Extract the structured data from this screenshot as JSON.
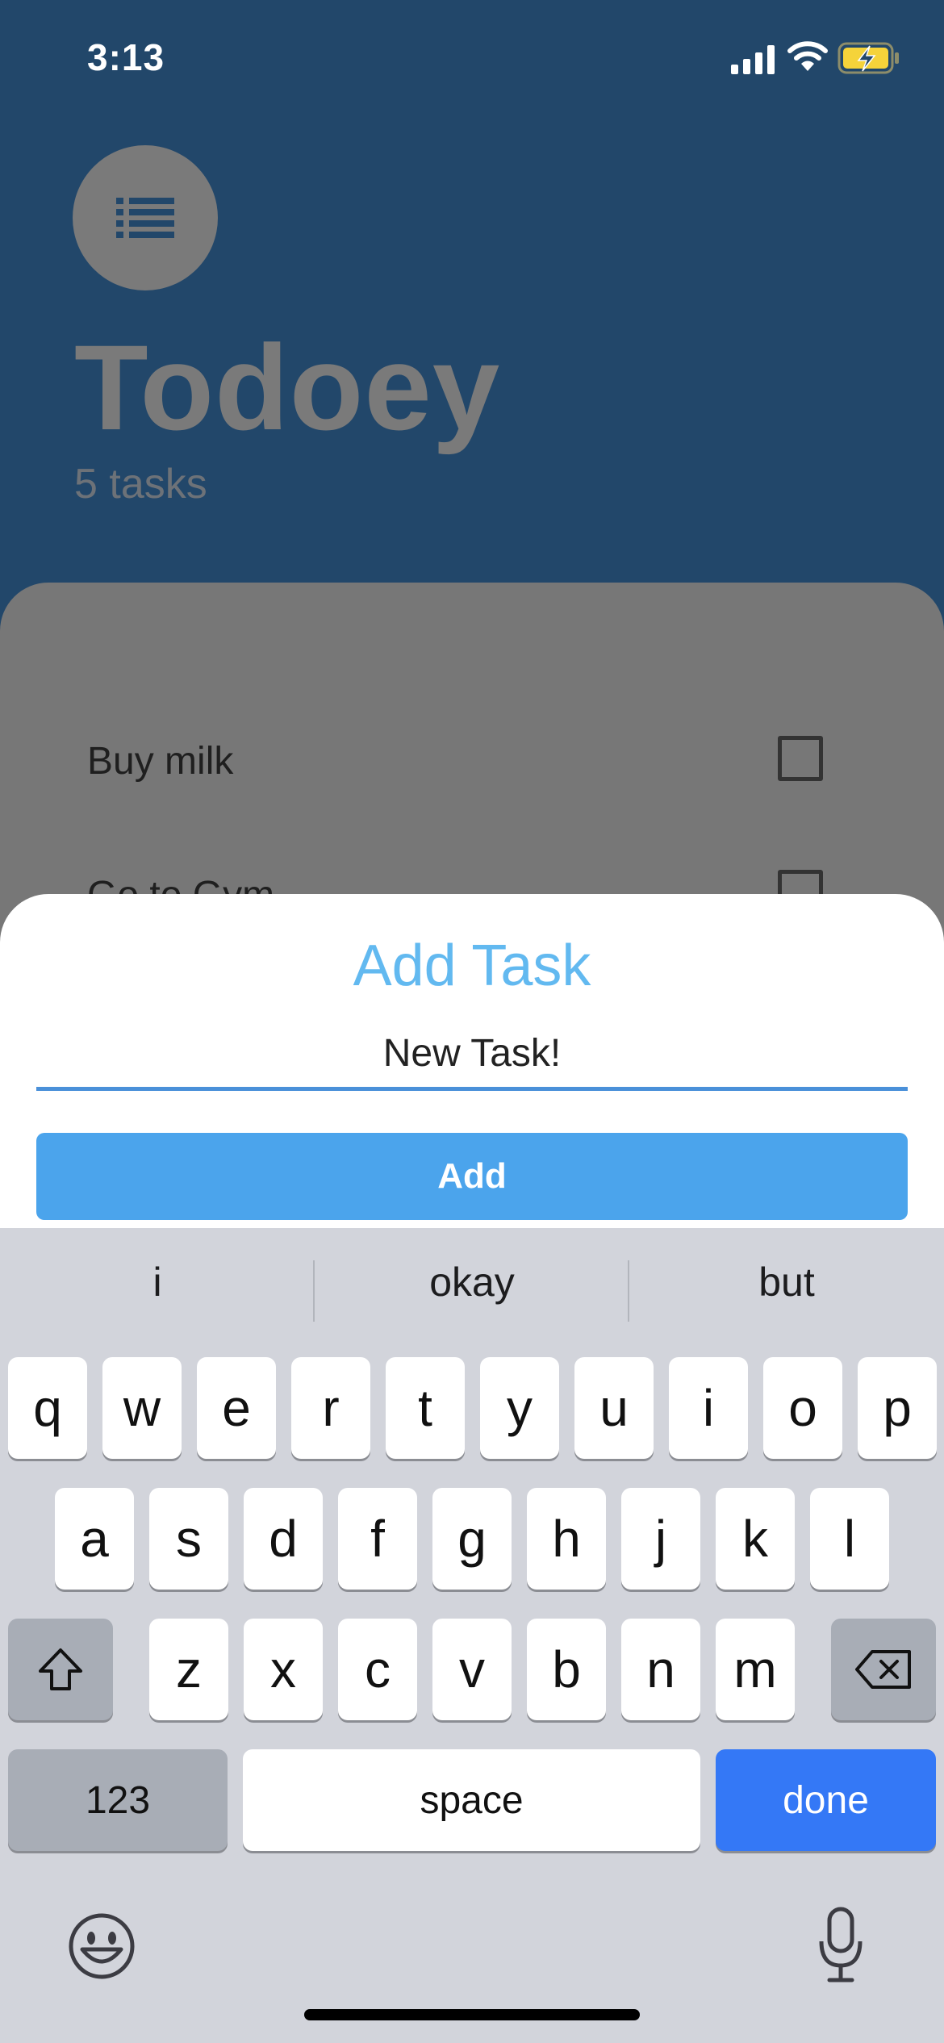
{
  "status_bar": {
    "time": "3:13",
    "icons": [
      "signal-icon",
      "wifi-icon",
      "battery-charging-icon"
    ]
  },
  "header": {
    "icon": "list-icon",
    "title": "Todoey",
    "task_count": "5 tasks"
  },
  "tasks": [
    {
      "label": "Buy milk",
      "done": false
    },
    {
      "label": "Go to Gym",
      "done": false
    }
  ],
  "add_task_sheet": {
    "title": "Add Task",
    "input_value": "New Task!",
    "add_label": "Add"
  },
  "keyboard": {
    "suggestions": [
      "i",
      "okay",
      "but"
    ],
    "row1": [
      "q",
      "w",
      "e",
      "r",
      "t",
      "y",
      "u",
      "i",
      "o",
      "p"
    ],
    "row2": [
      "a",
      "s",
      "d",
      "f",
      "g",
      "h",
      "j",
      "k",
      "l"
    ],
    "row3": [
      "z",
      "x",
      "c",
      "v",
      "b",
      "n",
      "m"
    ],
    "numbers_label": "123",
    "space_label": "space",
    "done_label": "done",
    "icons": [
      "shift-icon",
      "backspace-icon",
      "emoji-icon",
      "microphone-icon"
    ]
  },
  "colors": {
    "app_background": "#22476a",
    "accent": "#62b9f0",
    "add_button": "#4ba4ec",
    "done_key": "#3478f6"
  }
}
